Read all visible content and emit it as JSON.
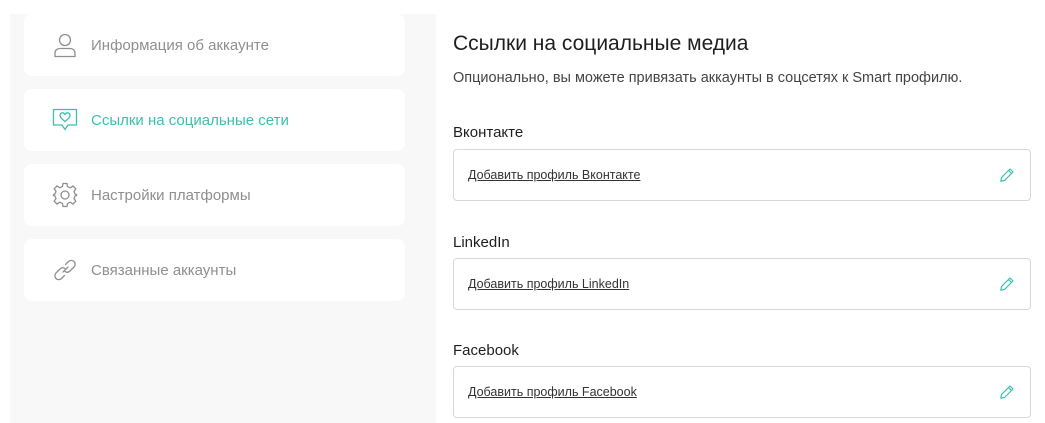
{
  "sidebar": {
    "items": [
      {
        "label": "Информация об аккаунте",
        "icon": "user-icon",
        "active": false
      },
      {
        "label": "Ссылки на социальные сети",
        "icon": "heart-message-icon",
        "active": true
      },
      {
        "label": "Настройки платформы",
        "icon": "gear-icon",
        "active": false
      },
      {
        "label": "Связанные аккаунты",
        "icon": "link-icon",
        "active": false
      }
    ]
  },
  "main": {
    "title": "Ссылки на социальные медиа",
    "subtitle": "Опционально, вы можете привязать аккаунты в соцсетях к Smart профилю.",
    "fields": [
      {
        "label": "Вконтакте",
        "link_text": "Добавить профиль Вконтакте"
      },
      {
        "label": "LinkedIn",
        "link_text": "Добавить профиль LinkedIn"
      },
      {
        "label": "Facebook",
        "link_text": "Добавить профиль Facebook"
      }
    ]
  },
  "colors": {
    "accent": "#3bbfb0",
    "muted_text": "#8f8f8f",
    "sidebar_bg": "#f8f8f8",
    "border": "#d8d8d8"
  }
}
